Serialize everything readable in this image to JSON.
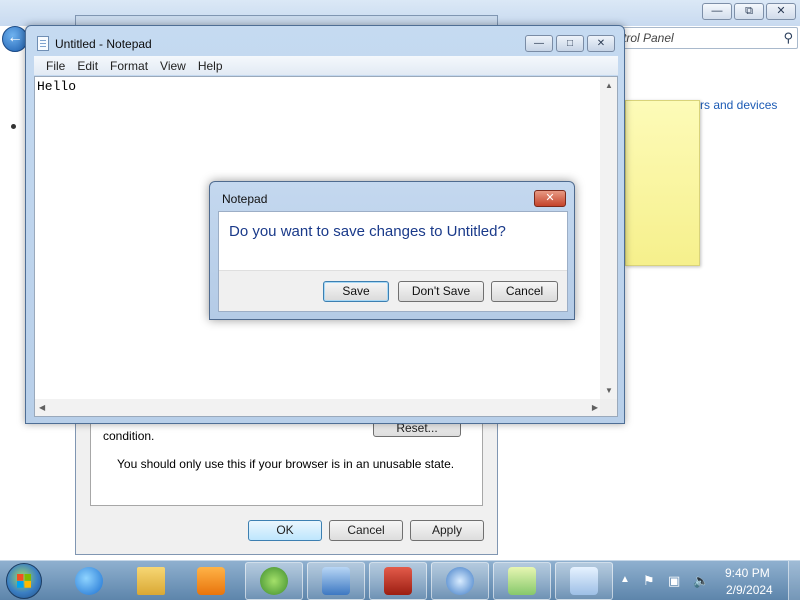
{
  "control_panel": {
    "address": "trol Panel",
    "link": "rs and devices"
  },
  "internet_options": {
    "reset_label": "Reset...",
    "condition_text": "condition.",
    "warning_text": "You should only use this if your browser is in an unusable state.",
    "ok_label": "OK",
    "cancel_label": "Cancel",
    "apply_label": "Apply"
  },
  "notepad": {
    "title": "Untitled - Notepad",
    "menu": [
      "File",
      "Edit",
      "Format",
      "View",
      "Help"
    ],
    "content": "Hello"
  },
  "save_dialog": {
    "title": "Notepad",
    "message": "Do you want to save changes to Untitled?",
    "save_label": "Save",
    "dont_save_label": "Don't Save",
    "cancel_label": "Cancel"
  },
  "taskbar": {
    "items": [
      {
        "name": "internet-explorer",
        "icon": "ie-icon"
      },
      {
        "name": "windows-explorer",
        "icon": "folder-icon"
      },
      {
        "name": "media-player",
        "icon": "media-icon"
      },
      {
        "name": "windows-app",
        "icon": "windows-icon"
      },
      {
        "name": "control-panel",
        "icon": "control-panel-icon"
      },
      {
        "name": "toolbox",
        "icon": "toolbox-icon"
      },
      {
        "name": "task-scheduler",
        "icon": "task-icon"
      },
      {
        "name": "sticky-notes",
        "icon": "sticky-notes-icon"
      },
      {
        "name": "notepad",
        "icon": "notepad-icon"
      }
    ],
    "time": "9:40 PM",
    "date": "2/9/2024"
  }
}
